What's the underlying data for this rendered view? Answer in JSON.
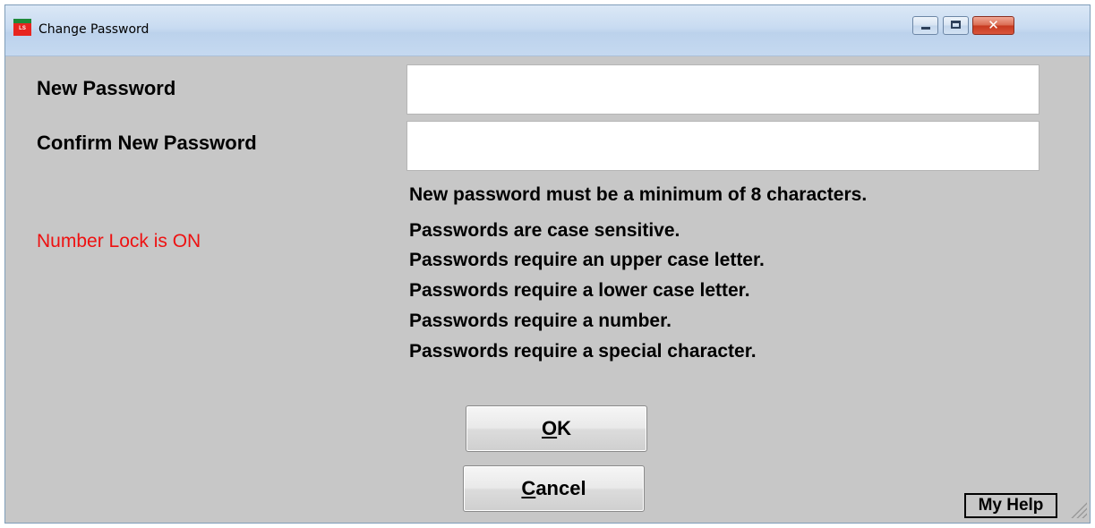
{
  "window": {
    "title": "Change Password",
    "icon": "app-icon",
    "controls": {
      "minimize": "minimize-icon",
      "maximize": "maximize-icon",
      "close": "✕"
    }
  },
  "form": {
    "new_password_label": "New Password",
    "new_password_value": "",
    "confirm_password_label": "Confirm New Password",
    "confirm_password_value": ""
  },
  "rules": [
    "New password must be a minimum of 8 characters.",
    "Passwords are case sensitive.",
    "Passwords require an upper case letter.",
    "Passwords require a lower case letter.",
    "Passwords require a number.",
    "Passwords require a special character."
  ],
  "status": {
    "numlock_text": "Number Lock is ON",
    "numlock_color": "#ee1111"
  },
  "buttons": {
    "ok_mnemonic": "O",
    "ok_rest": "K",
    "cancel_mnemonic": "C",
    "cancel_rest": "ancel",
    "help": "My Help"
  },
  "colors": {
    "dialog_background": "#c7c7c7",
    "title_bar": "#c8dbf1"
  }
}
